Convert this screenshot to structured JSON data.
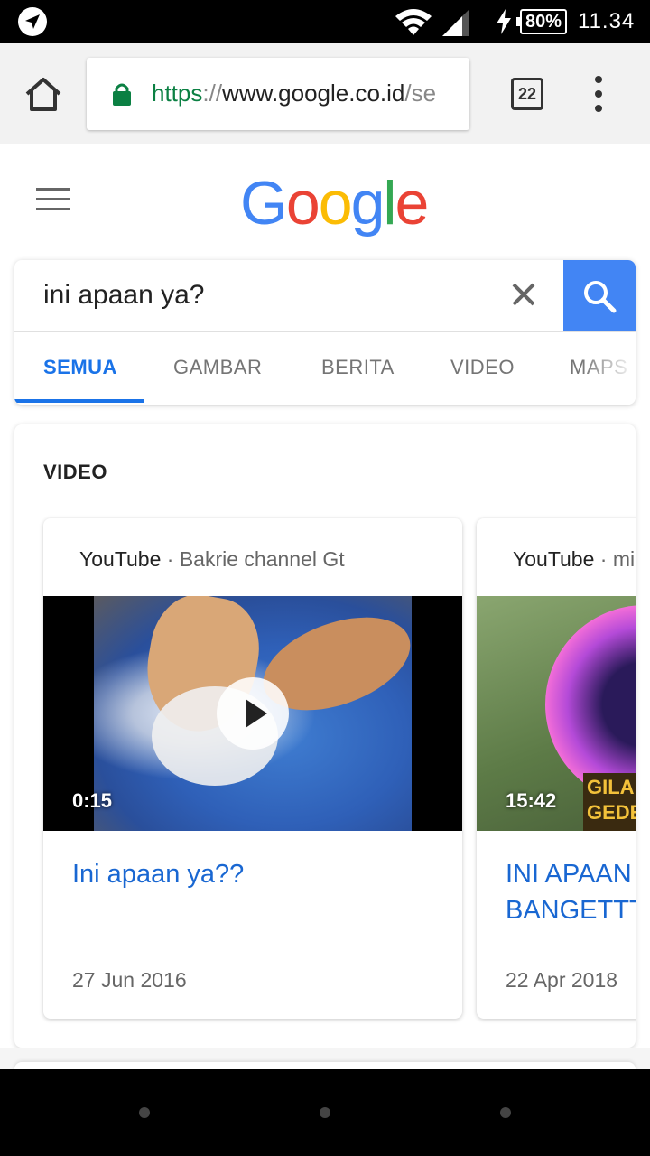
{
  "status_bar": {
    "battery": "80%",
    "time": "11.34"
  },
  "browser": {
    "url_scheme": "https",
    "url_sep": "://",
    "url_host": "www.google.co.id",
    "url_rest": "/se",
    "tab_count": "22"
  },
  "search": {
    "query": "ini apaan ya?",
    "tabs": [
      {
        "label": "SEMUA"
      },
      {
        "label": "GAMBAR"
      },
      {
        "label": "BERITA"
      },
      {
        "label": "VIDEO"
      },
      {
        "label": "MAPS"
      }
    ]
  },
  "logo": {
    "letters": [
      "G",
      "o",
      "o",
      "g",
      "l",
      "e"
    ]
  },
  "video_section": {
    "title": "VIDEO",
    "cards": [
      {
        "source": "YouTube",
        "channel": " · Bakrie channel Gt",
        "duration": "0:15",
        "title": "Ini apaan ya??",
        "date": "27 Jun 2016"
      },
      {
        "source": "YouTube",
        "channel": " · mic",
        "duration": "15:42",
        "title": "INI APAAN BANGETTT",
        "date": "22 Apr 2018",
        "thumb_text": "GILA\nGEDE"
      }
    ]
  }
}
